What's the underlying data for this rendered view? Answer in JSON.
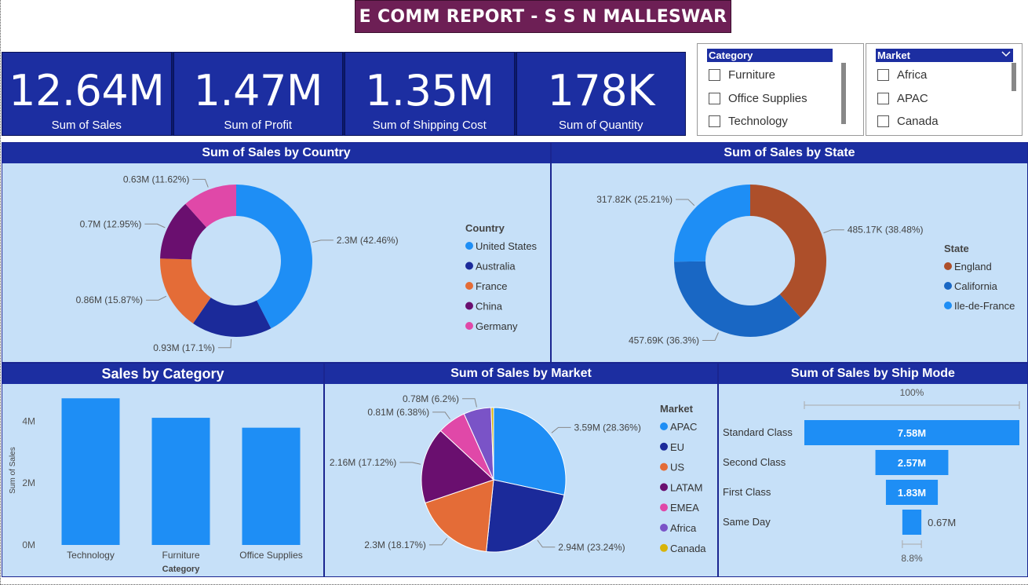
{
  "title": "E COMM REPORT - S S N MALLESWAR",
  "kpis": [
    {
      "value": "12.64M",
      "label": "Sum of Sales"
    },
    {
      "value": "1.47M",
      "label": "Sum of Profit"
    },
    {
      "value": "1.35M",
      "label": "Sum of Shipping Cost"
    },
    {
      "value": "178K",
      "label": "Sum of Quantity"
    }
  ],
  "slicers": {
    "category": {
      "title": "Category",
      "items": [
        "Furniture",
        "Office Supplies",
        "Technology"
      ]
    },
    "market": {
      "title": "Market",
      "items": [
        "Africa",
        "APAC",
        "Canada"
      ]
    }
  },
  "panels": {
    "country": "Sum of Sales by Country",
    "state": "Sum of Sales by State",
    "category": "Sales by Category",
    "market": "Sum of Sales by Market",
    "shipmode": "Sum of Sales by Ship Mode"
  },
  "colors": {
    "accent": "#1c2ea1",
    "title_bg": "#6d1f55",
    "panel_bg": "#c6e0f8"
  },
  "chart_data": [
    {
      "id": "country",
      "type": "donut",
      "title": "Sum of Sales by Country",
      "legend_title": "Country",
      "legend_position": "right",
      "slices": [
        {
          "name": "United States",
          "value": 2.3,
          "label": "2.3M (42.46%)",
          "color": "#1e8ef5"
        },
        {
          "name": "Australia",
          "value": 0.93,
          "label": "0.93M (17.1%)",
          "color": "#1b2a9a"
        },
        {
          "name": "France",
          "value": 0.86,
          "label": "0.86M (15.87%)",
          "color": "#e46c37"
        },
        {
          "name": "China",
          "value": 0.7,
          "label": "0.7M (12.95%)",
          "color": "#6a0f6f"
        },
        {
          "name": "Germany",
          "value": 0.63,
          "label": "0.63M (11.62%)",
          "color": "#e048a8"
        }
      ]
    },
    {
      "id": "state",
      "type": "donut",
      "title": "Sum of Sales by State",
      "legend_title": "State",
      "legend_position": "right",
      "slices": [
        {
          "name": "England",
          "value": 485.17,
          "label": "485.17K (38.48%)",
          "color": "#ad4f2a"
        },
        {
          "name": "California",
          "value": 457.69,
          "label": "457.69K (36.3%)",
          "color": "#1967c4"
        },
        {
          "name": "Ile-de-France",
          "value": 317.82,
          "label": "317.82K (25.21%)",
          "color": "#1e8ef5"
        }
      ]
    },
    {
      "id": "category",
      "type": "bar",
      "title": "Sales by Category",
      "categories": [
        "Technology",
        "Furniture",
        "Office Supplies"
      ],
      "values": [
        4.74,
        4.11,
        3.79
      ],
      "xlabel": "Category",
      "ylabel": "Sum of Sales",
      "ylim": [
        0,
        5
      ],
      "yticks": [
        "0M",
        "2M",
        "4M"
      ],
      "color": "#1e8ef5"
    },
    {
      "id": "market",
      "type": "pie",
      "title": "Sum of Sales by Market",
      "legend_title": "Market",
      "legend_position": "right",
      "slices": [
        {
          "name": "APAC",
          "value": 3.59,
          "label": "3.59M (28.36%)",
          "color": "#1e8ef5"
        },
        {
          "name": "EU",
          "value": 2.94,
          "label": "2.94M (23.24%)",
          "color": "#1b2a9a"
        },
        {
          "name": "US",
          "value": 2.3,
          "label": "2.3M (18.17%)",
          "color": "#e46c37"
        },
        {
          "name": "LATAM",
          "value": 2.16,
          "label": "2.16M (17.12%)",
          "color": "#6a0f6f"
        },
        {
          "name": "EMEA",
          "value": 0.81,
          "label": "0.81M (6.38%)",
          "color": "#e048a8"
        },
        {
          "name": "Africa",
          "value": 0.78,
          "label": "0.78M (6.2%)",
          "color": "#7a53c7"
        },
        {
          "name": "Canada",
          "value": 0.07,
          "label": "",
          "color": "#d8b40a"
        }
      ]
    },
    {
      "id": "shipmode",
      "type": "funnel",
      "title": "Sum of Sales by Ship Mode",
      "categories": [
        "Standard Class",
        "Second Class",
        "First Class",
        "Same Day"
      ],
      "values": [
        7.58,
        2.57,
        1.83,
        0.67
      ],
      "value_labels": [
        "7.58M",
        "2.57M",
        "1.83M",
        "0.67M"
      ],
      "top_percent": "100%",
      "bottom_percent": "8.8%",
      "color": "#1e8ef5"
    }
  ]
}
